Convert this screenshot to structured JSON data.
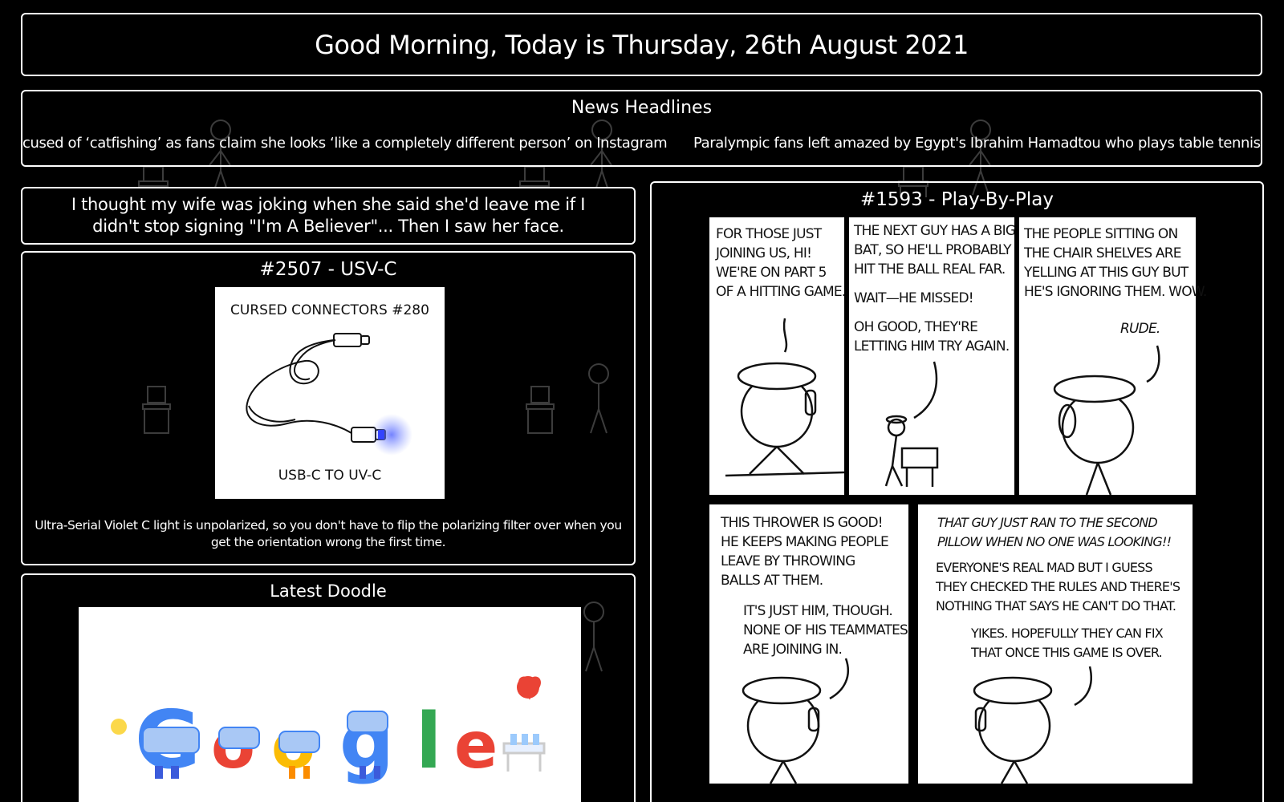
{
  "greeting": {
    "text": "Good Morning, Today is Thursday, 26th August 2021"
  },
  "news": {
    "title": "News Headlines",
    "headlines": [
      "cused of ‘catfishing’ as fans claim she looks ‘like a completely different person’ on Instagram",
      "Paralympic fans left amazed by Egypt's Ibrahim Hamadtou who plays table tennis"
    ]
  },
  "joke": {
    "text": "I thought my wife was joking when she said she'd leave me if I didn't stop signing \"I'm A Believer\"... Then I saw her face."
  },
  "xkcd_small": {
    "title": "#2507 - USV-C",
    "comic_title": "CURSED CONNECTORS #280",
    "comic_label": "USB-C TO UV-C",
    "caption": "Ultra-Serial Violet C light is unpolarized, so you don't have to flip the polarizing filter over when you get the orientation wrong the first time."
  },
  "doodle": {
    "title": "Latest Doodle"
  },
  "xkcd_big": {
    "title": "#1593 - Play-By-Play",
    "panels": [
      {
        "lines": [
          "FOR THOSE JUST",
          "JOINING US, HI!",
          "WE'RE ON PART 5",
          "OF A HITTING GAME."
        ]
      },
      {
        "lines": [
          "THE NEXT GUY HAS A BIG",
          "BAT, SO HE'LL PROBABLY",
          "HIT THE BALL REAL FAR."
        ],
        "lines2": [
          "WAIT—HE MISSED!"
        ],
        "lines3": [
          "OH GOOD, THEY'RE",
          "LETTING HIM TRY AGAIN."
        ]
      },
      {
        "lines": [
          "THE PEOPLE SITTING ON",
          "THE CHAIR SHELVES ARE",
          "YELLING AT THIS GUY BUT",
          "HE'S IGNORING THEM. WOW."
        ],
        "lines2": [
          "RUDE."
        ]
      },
      {
        "lines": [
          "THIS THROWER IS GOOD!",
          "HE KEEPS MAKING PEOPLE",
          "LEAVE BY THROWING",
          "BALLS AT THEM."
        ],
        "lines2": [
          "IT'S JUST HIM, THOUGH.",
          "NONE OF HIS TEAMMATES",
          "ARE JOINING IN."
        ]
      },
      {
        "lines": [
          "THAT GUY JUST RAN TO THE SECOND",
          "PILLOW WHEN NO ONE WAS LOOKING!!"
        ],
        "lines2": [
          "EVERYONE'S REAL MAD BUT I GUESS",
          "THEY CHECKED THE RULES AND THERE'S",
          "NOTHING THAT SAYS HE CAN'T DO THAT."
        ],
        "lines3": [
          "YIKES. HOPEFULLY THEY CAN FIX",
          "THAT ONCE THIS GAME IS OVER."
        ]
      }
    ]
  },
  "colors": {
    "background": "#000000",
    "border": "#ffffff",
    "text": "#ffffff"
  }
}
